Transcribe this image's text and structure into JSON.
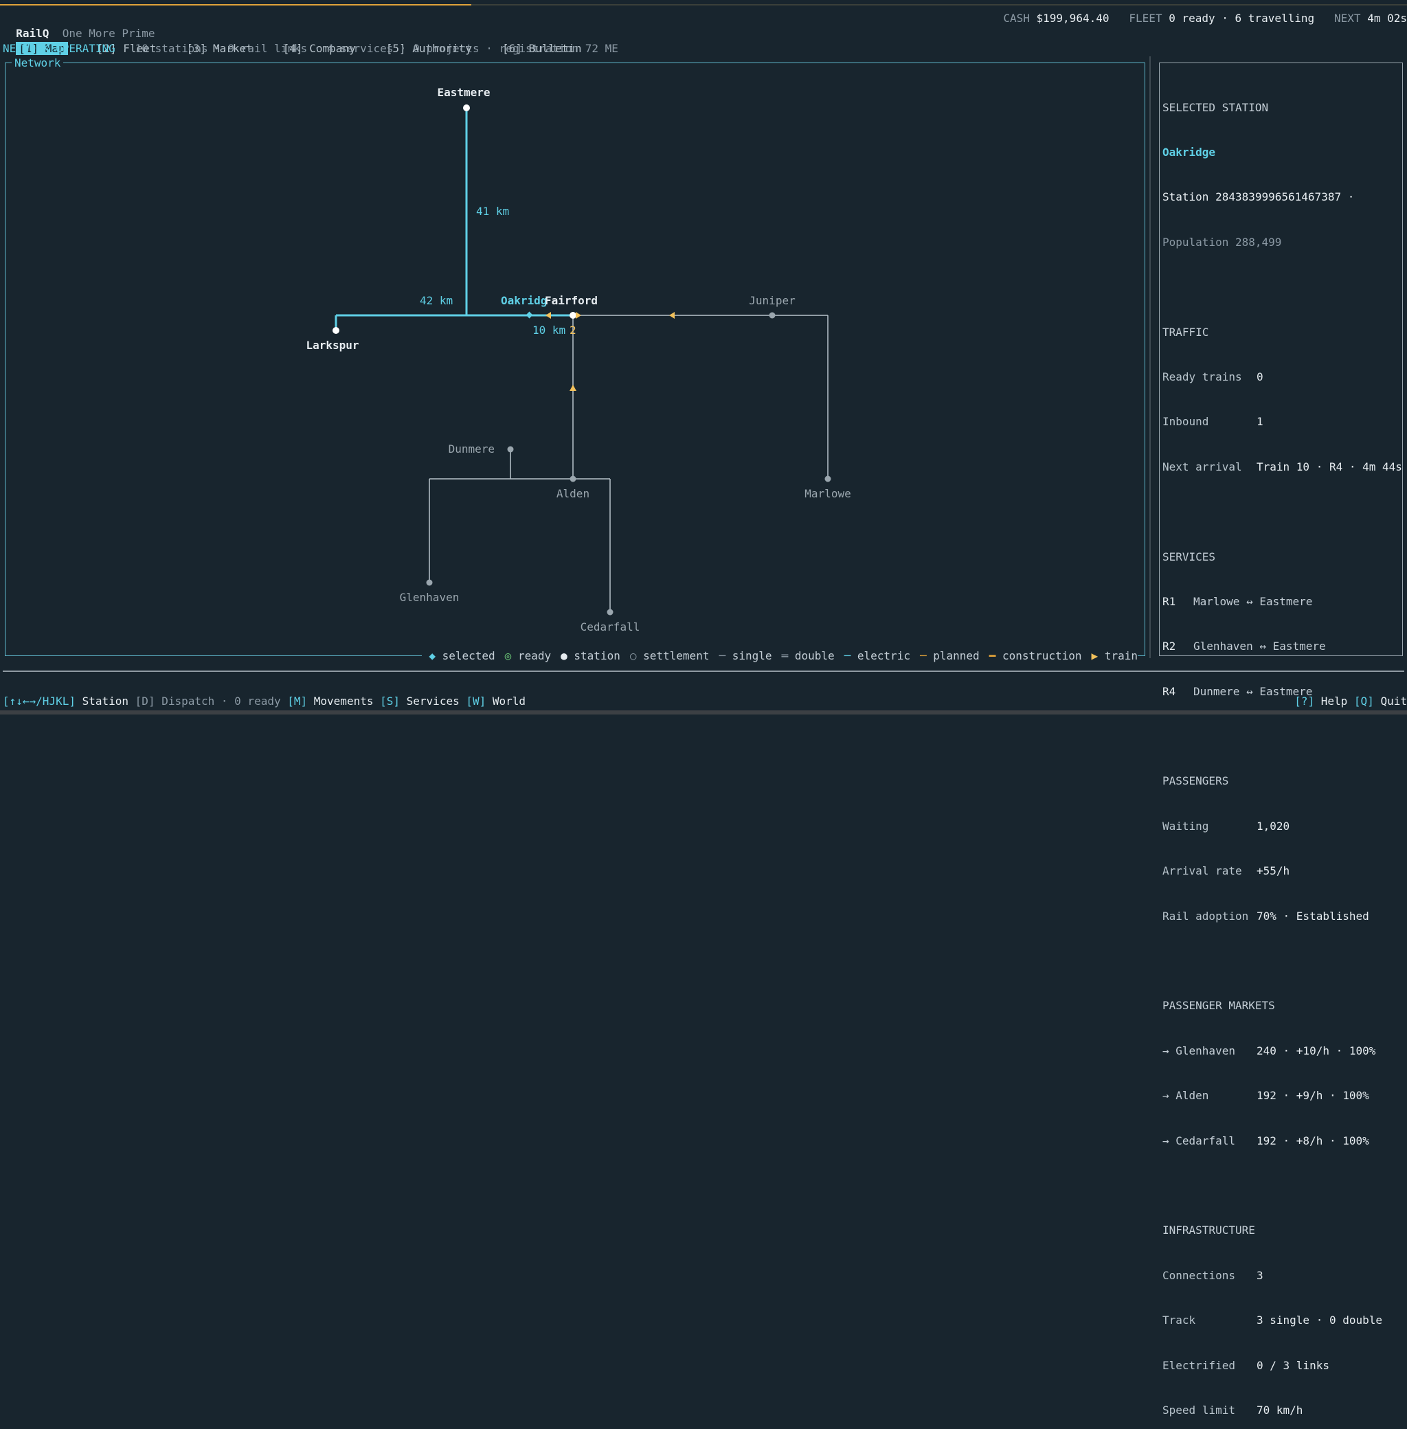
{
  "app": {
    "name": "RailQ",
    "subtitle": "One More Prime"
  },
  "progress": {
    "fraction": 0.335
  },
  "topbar": {
    "cash_label": "CASH",
    "cash_value": "$199,964.40",
    "fleet_label": "FLEET",
    "fleet_value": "0 ready · 6 travelling",
    "next_label": "NEXT",
    "next_value": "4m 02s"
  },
  "tabs": [
    "[1] Map",
    "[2] Fleet",
    "[3] Market",
    "[4] Company",
    "[5] Authority",
    "[6] Bulletin"
  ],
  "status": {
    "state": "NETWORK OPERATING",
    "details": " · 10 stations · 9 rail links · 4 services · 0 projects · registration 72 ME"
  },
  "network": {
    "title": "Network",
    "stations": {
      "eastmere": "Eastmere",
      "larkspur": "Larkspur",
      "oakridge": "Oakridg",
      "fairford": "Fairford",
      "juniper": "Juniper",
      "dunmere": "Dunmere",
      "alden": "Alden",
      "marlowe": "Marlowe",
      "glenhaven": "Glenhaven",
      "cedarfall": "Cedarfall"
    },
    "distances": {
      "eastmere_link": "41 km",
      "larkspur_link": "42 km",
      "fairford_link": "10 km"
    },
    "train_count": "2",
    "colors": {
      "selected": "#5fd0e6",
      "station": "#ffffff",
      "settlement": "#9aa6ae",
      "train": "#f2c15b",
      "planned": "#e0a33a"
    }
  },
  "legend": {
    "selected": "selected",
    "ready": "ready",
    "station": "station",
    "settlement": "settlement",
    "single": "single",
    "double": "double",
    "electric": "electric",
    "planned": "planned",
    "construction": "construction",
    "train": "train"
  },
  "sidebar": {
    "heading": "SELECTED STATION",
    "name": "Oakridge",
    "station_id": "Station 2843839996561467387 ·",
    "population": "Population 288,499",
    "traffic": {
      "title": "TRAFFIC",
      "ready_label": "Ready trains",
      "ready_value": "0",
      "inbound_label": "Inbound",
      "inbound_value": "1",
      "next_label": "Next arrival",
      "next_value": "Train 10 · R4 · 4m 44s"
    },
    "services": {
      "title": "SERVICES",
      "items": [
        {
          "code": "R1",
          "route": "Marlowe ↔ Eastmere"
        },
        {
          "code": "R2",
          "route": "Glenhaven ↔ Eastmere"
        },
        {
          "code": "R4",
          "route": "Dunmere ↔ Eastmere"
        }
      ]
    },
    "passengers": {
      "title": "PASSENGERS",
      "waiting_label": "Waiting",
      "waiting_value": "1,020",
      "rate_label": "Arrival rate",
      "rate_value": "+55/h",
      "adoption_label": "Rail adoption",
      "adoption_value": "70% · Established"
    },
    "markets": {
      "title": "PASSENGER MARKETS",
      "items": [
        {
          "dest": "→ Glenhaven",
          "stats": "240 · +10/h · 100%"
        },
        {
          "dest": "→ Alden",
          "stats": "192 · +9/h · 100%"
        },
        {
          "dest": "→ Cedarfall",
          "stats": "192 · +8/h · 100%"
        }
      ]
    },
    "infrastructure": {
      "title": "INFRASTRUCTURE",
      "conn_label": "Connections",
      "conn_value": "3",
      "track_label": "Track",
      "track_value": "3 single · 0 double",
      "elec_label": "Electrified",
      "elec_value": "0 / 3 links",
      "speed_label": "Speed limit",
      "speed_value": "70 km/h"
    }
  },
  "bottombar": {
    "nav_keys": "[↑↓←→/HJKL]",
    "nav_label": " Station ",
    "dispatch": "[D] Dispatch · 0 ready ",
    "mov_key": "[M]",
    "mov_label": " Movements ",
    "svc_key": "[S]",
    "svc_label": " Services ",
    "world_key": "[W]",
    "world_label": " World",
    "help_key": "[?]",
    "help_label": " Help ",
    "quit_key": "[Q]",
    "quit_label": " Quit"
  }
}
